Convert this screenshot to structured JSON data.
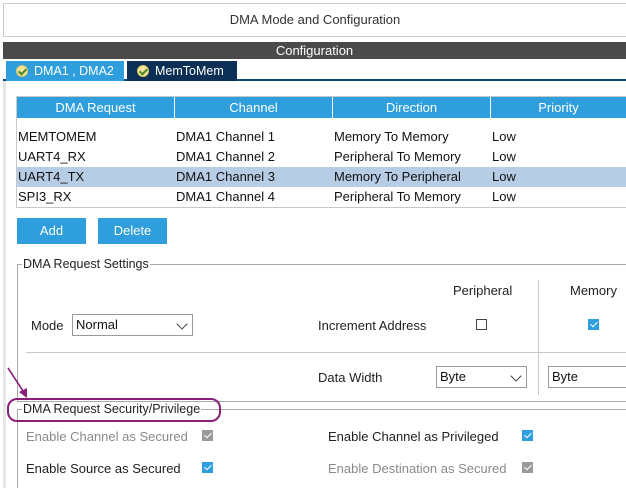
{
  "title": "DMA Mode and Configuration",
  "config_label": "Configuration",
  "tabs": [
    {
      "label": "DMA1 , DMA2",
      "active": true
    },
    {
      "label": "MemToMem",
      "active": false
    }
  ],
  "table": {
    "headers": [
      "DMA Request",
      "Channel",
      "Direction",
      "Priority"
    ],
    "rows": [
      {
        "request": "MEMTOMEM",
        "channel": "DMA1 Channel 1",
        "direction": "Memory To Memory",
        "priority": "Low",
        "selected": false
      },
      {
        "request": "UART4_RX",
        "channel": "DMA1 Channel 2",
        "direction": "Peripheral To Memory",
        "priority": "Low",
        "selected": false
      },
      {
        "request": "UART4_TX",
        "channel": "DMA1 Channel 3",
        "direction": "Memory To Peripheral",
        "priority": "Low",
        "selected": true
      },
      {
        "request": "SPI3_RX",
        "channel": "DMA1 Channel 4",
        "direction": "Peripheral To Memory",
        "priority": "Low",
        "selected": false
      }
    ]
  },
  "buttons": {
    "add": "Add",
    "delete": "Delete"
  },
  "settings": {
    "legend": "DMA Request Settings",
    "peripheral_header": "Peripheral",
    "memory_header": "Memory",
    "mode_label": "Mode",
    "mode_value": "Normal",
    "increment_label": "Increment Address",
    "increment_peripheral": false,
    "increment_memory": true,
    "data_width_label": "Data Width",
    "data_width_peripheral": "Byte",
    "data_width_memory": "Byte"
  },
  "security": {
    "legend": "DMA Request Security/Privilege",
    "channel_secured_label": "Enable Channel as Secured",
    "channel_secured": true,
    "channel_privileged_label": "Enable Channel as Privileged",
    "channel_privileged": true,
    "source_secured_label": "Enable Source as Secured",
    "source_secured": true,
    "destination_secured_label": "Enable Destination as Secured",
    "destination_secured": true
  },
  "colors": {
    "accent": "#2e9fdc",
    "tab_dark": "#0b2f55",
    "selected_row": "#b7cde6",
    "annotation": "#8a1f7a"
  }
}
